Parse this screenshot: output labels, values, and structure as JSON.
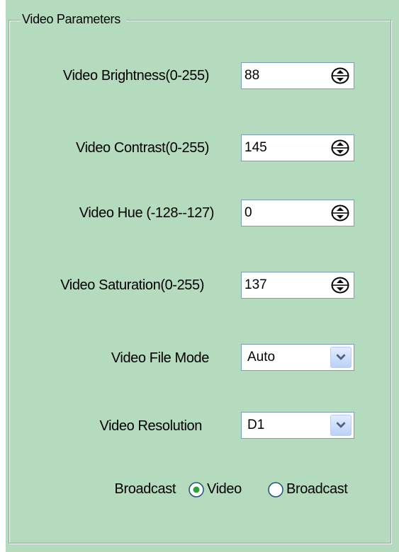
{
  "group": {
    "title": "Video Parameters"
  },
  "spinners": [
    {
      "label": "Video Brightness(0-255)",
      "value": "88"
    },
    {
      "label": "Video Contrast(0-255)",
      "value": "145"
    },
    {
      "label": "Video Hue (-128--127)",
      "value": "0"
    },
    {
      "label": "Video Saturation(0-255)",
      "value": "137"
    }
  ],
  "file_mode": {
    "label": "Video File Mode",
    "value": "Auto"
  },
  "resolution": {
    "label": "Video Resolution",
    "value": "D1"
  },
  "broadcast": {
    "label": "Broadcast",
    "options": [
      {
        "label": "Video",
        "selected": true
      },
      {
        "label": "Broadcast",
        "selected": false
      }
    ]
  },
  "colors": {
    "panel_bg": "#b5dbbf",
    "field_border": "#7f9db9",
    "radio_selected": "#2ca33a"
  }
}
